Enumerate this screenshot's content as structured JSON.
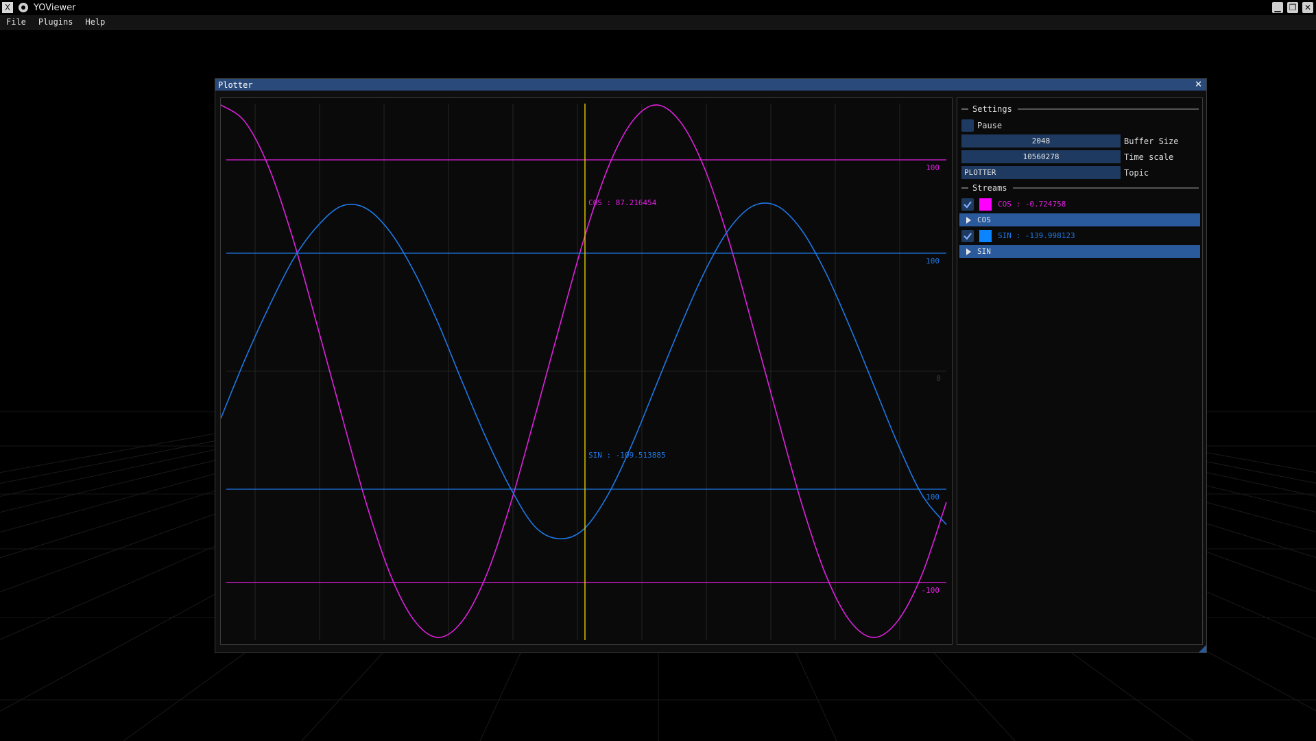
{
  "os_window": {
    "title": "YOViewer",
    "app_icon": "x-app-icon",
    "pin_icon": "pin-icon",
    "controls": [
      "minimize-icon",
      "restore-icon",
      "close-icon"
    ],
    "minimize_glyph": "▁",
    "restore_glyph": "❐",
    "close_glyph": "✕"
  },
  "menubar": {
    "items": [
      "File",
      "Plugins",
      "Help"
    ]
  },
  "plotter": {
    "title": "Plotter",
    "close_glyph": "✕"
  },
  "settings": {
    "header": "Settings",
    "pause_label": "Pause",
    "pause_checked": false,
    "buffer_size_value": "2048",
    "buffer_size_label": "Buffer Size",
    "time_scale_value": "10560278",
    "time_scale_label": "Time scale",
    "topic_value": "PLOTTER",
    "topic_label": "Topic"
  },
  "streams": {
    "header": "Streams",
    "items": [
      {
        "name": "COS",
        "label": "COS : -0.724758",
        "color": "#ff00ff",
        "checked": true
      },
      {
        "name": "SIN",
        "label": "SIN : -139.998123",
        "color": "#0a84ff",
        "checked": true
      }
    ]
  },
  "colors": {
    "cos": "#e020e0",
    "sin": "#1e78e6",
    "cursor": "#e8d000",
    "accent": "#2a5a9c",
    "field_bg": "#1f3a60"
  },
  "chart_data": {
    "type": "line",
    "cursor_readouts": {
      "cos": "COS : 87.216454",
      "sin": "SIN : -109.513885"
    },
    "series": [
      {
        "name": "COS",
        "x": [
          0,
          0.1,
          0.2,
          0.3,
          0.4,
          0.5,
          0.6,
          0.7,
          0.8,
          0.9,
          1.0,
          1.1,
          1.2,
          1.3,
          1.4,
          1.5,
          1.6,
          1.7,
          1.8,
          1.9,
          2.0,
          2.1,
          2.2,
          2.3,
          2.4,
          2.5,
          2.6,
          2.7,
          2.8,
          2.9,
          3.0
        ],
        "values": [
          126,
          118,
          96,
          62,
          21,
          -21,
          -62,
          -96,
          -118,
          -126,
          -118,
          -96,
          -62,
          -21,
          21,
          62,
          96,
          118,
          126,
          118,
          96,
          62,
          21,
          -21,
          -62,
          -96,
          -118,
          -126,
          -118,
          -96,
          -62
        ],
        "ref_lines": {
          "upper": 100,
          "lower": -100
        },
        "ref_labels": {
          "upper": "100",
          "lower": "-100"
        }
      },
      {
        "name": "SIN",
        "x": [
          0,
          0.1,
          0.2,
          0.3,
          0.4,
          0.5,
          0.6,
          0.7,
          0.8,
          0.9,
          1.0,
          1.1,
          1.2,
          1.3,
          1.4,
          1.5,
          1.6,
          1.7,
          1.8,
          1.9,
          2.0,
          2.1,
          2.2,
          2.3,
          2.4,
          2.5,
          2.6,
          2.7,
          2.8,
          2.9,
          3.0
        ],
        "values": [
          -40,
          10,
          55,
          95,
          123,
          140,
          138,
          118,
          84,
          40,
          -10,
          -58,
          -100,
          -132,
          -142,
          -134,
          -105,
          -62,
          -12,
          38,
          84,
          120,
          140,
          140,
          120,
          84,
          38,
          -12,
          -62,
          -105,
          -130
        ],
        "ref_lines": {
          "upper": 100,
          "lower": -100
        },
        "ref_labels": {
          "upper": "100",
          "lower": "-100"
        }
      }
    ],
    "zero_label": "0"
  }
}
